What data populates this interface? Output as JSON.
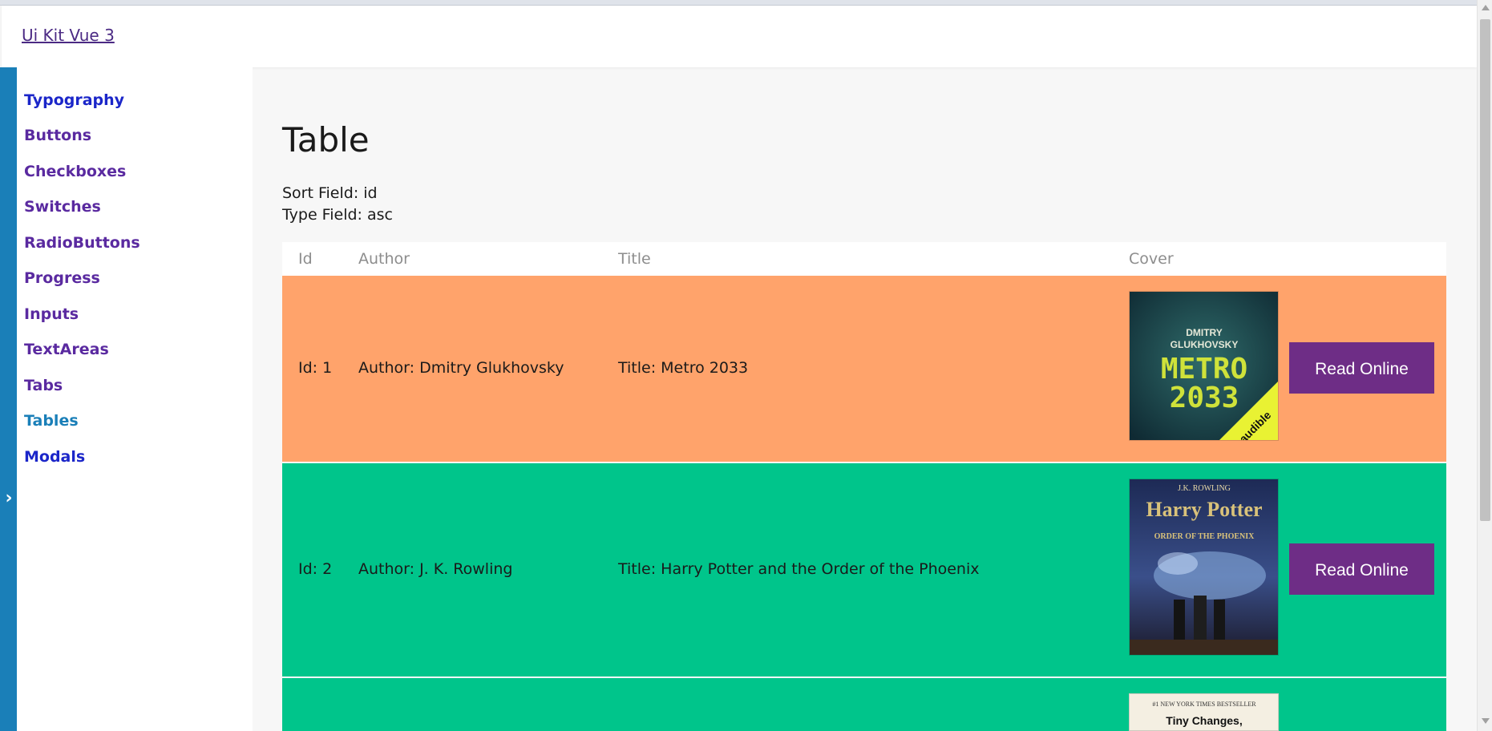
{
  "header": {
    "brand": "Ui Kit Vue 3"
  },
  "sidebar": {
    "items": [
      {
        "label": "Typography"
      },
      {
        "label": "Buttons"
      },
      {
        "label": "Checkboxes"
      },
      {
        "label": "Switches"
      },
      {
        "label": "RadioButtons"
      },
      {
        "label": "Progress"
      },
      {
        "label": "Inputs"
      },
      {
        "label": "TextAreas"
      },
      {
        "label": "Tabs"
      },
      {
        "label": "Tables"
      },
      {
        "label": "Modals"
      }
    ],
    "active": "Tables",
    "toggle_icon": "chevron-right-icon"
  },
  "main": {
    "title": "Table",
    "sort_field": "Sort Field: id",
    "type_field": "Type Field: asc"
  },
  "table": {
    "columns": [
      "Id",
      "Author",
      "Title",
      "Cover"
    ],
    "rows": [
      {
        "id": "Id: 1",
        "author": "Author: Dmitry Glukhovsky",
        "title": "Title: Metro 2033",
        "cover": {
          "line1": "DMITRY",
          "line2": "GLUKHOVSKY",
          "line3": "METRO",
          "line4": "2033",
          "badge": "audible"
        },
        "button": "Read Online",
        "color": "#ffa36b"
      },
      {
        "id": "Id: 2",
        "author": "Author: J. K. Rowling",
        "title": "Title: Harry Potter and the Order of the Phoenix",
        "cover": {
          "line1": "J.K. ROWLING",
          "line2": "Harry Potter",
          "line3": "ORDER OF THE PHOENIX"
        },
        "button": "Read Online",
        "color": "#00c58b"
      },
      {
        "cover": {
          "line1": "#1 NEW YORK TIMES BESTSELLER",
          "line2": "Tiny Changes,"
        },
        "color": "#00c58b"
      }
    ]
  },
  "colors": {
    "accent": "#1a7fb8",
    "button": "#6e2d86",
    "orange_row": "#ffa36b",
    "green_row": "#00c58b"
  }
}
